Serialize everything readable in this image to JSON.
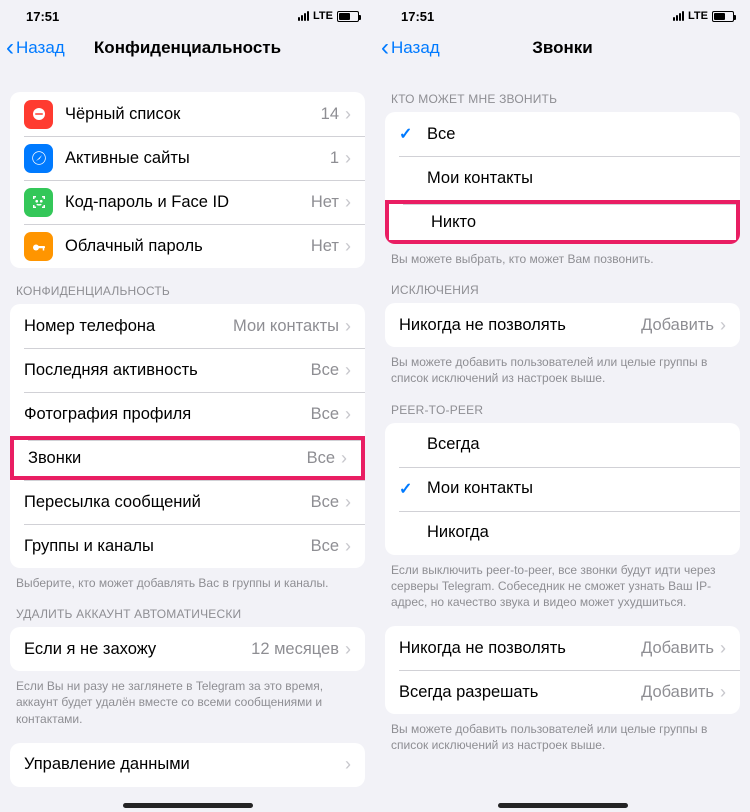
{
  "left": {
    "status": {
      "time": "17:51",
      "net": "LTE"
    },
    "nav": {
      "back": "Назад",
      "title": "Конфиденциальность"
    },
    "top_rows": [
      {
        "label": "Чёрный список",
        "value": "14"
      },
      {
        "label": "Активные сайты",
        "value": "1"
      },
      {
        "label": "Код-пароль и Face ID",
        "value": "Нет"
      },
      {
        "label": "Облачный пароль",
        "value": "Нет"
      }
    ],
    "privacy_header": "КОНФИДЕНЦИАЛЬНОСТЬ",
    "privacy_rows": [
      {
        "label": "Номер телефона",
        "value": "Мои контакты"
      },
      {
        "label": "Последняя активность",
        "value": "Все"
      },
      {
        "label": "Фотография профиля",
        "value": "Все"
      },
      {
        "label": "Звонки",
        "value": "Все"
      },
      {
        "label": "Пересылка сообщений",
        "value": "Все"
      },
      {
        "label": "Группы и каналы",
        "value": "Все"
      }
    ],
    "privacy_footer": "Выберите, кто может добавлять Вас в группы и каналы.",
    "delete_header": "УДАЛИТЬ АККАУНТ АВТОМАТИЧЕСКИ",
    "delete_row": {
      "label": "Если я не захожу",
      "value": "12 месяцев"
    },
    "delete_footer": "Если Вы ни разу не заглянете в Telegram за это время, аккаунт будет удалён вместе со всеми сообщениями и контактами.",
    "data_row_label": "Управление данными"
  },
  "right": {
    "status": {
      "time": "17:51",
      "net": "LTE"
    },
    "nav": {
      "back": "Назад",
      "title": "Звонки"
    },
    "who_header": "КТО МОЖЕТ МНЕ ЗВОНИТЬ",
    "who_rows": [
      {
        "label": "Все",
        "checked": true
      },
      {
        "label": "Мои контакты",
        "checked": false
      },
      {
        "label": "Никто",
        "checked": false
      }
    ],
    "who_footer": "Вы можете выбрать, кто может Вам позвонить.",
    "exc_header": "ИСКЛЮЧЕНИЯ",
    "exc_row": {
      "label": "Никогда не позволять",
      "value": "Добавить"
    },
    "exc_footer": "Вы можете добавить пользователей или целые группы в список исключений из настроек выше.",
    "p2p_header": "PEER-TO-PEER",
    "p2p_rows": [
      {
        "label": "Всегда",
        "checked": false
      },
      {
        "label": "Мои контакты",
        "checked": true
      },
      {
        "label": "Никогда",
        "checked": false
      }
    ],
    "p2p_footer": "Если выключить peer-to-peer, все звонки будут идти через серверы Telegram. Собеседник не сможет узнать Ваш IP-адрес, но качество звука и видео может ухудшиться.",
    "bottom_rows": [
      {
        "label": "Никогда не позволять",
        "value": "Добавить"
      },
      {
        "label": "Всегда разрешать",
        "value": "Добавить"
      }
    ],
    "bottom_footer": "Вы можете добавить пользователей или целые группы в список исключений из настроек выше."
  }
}
